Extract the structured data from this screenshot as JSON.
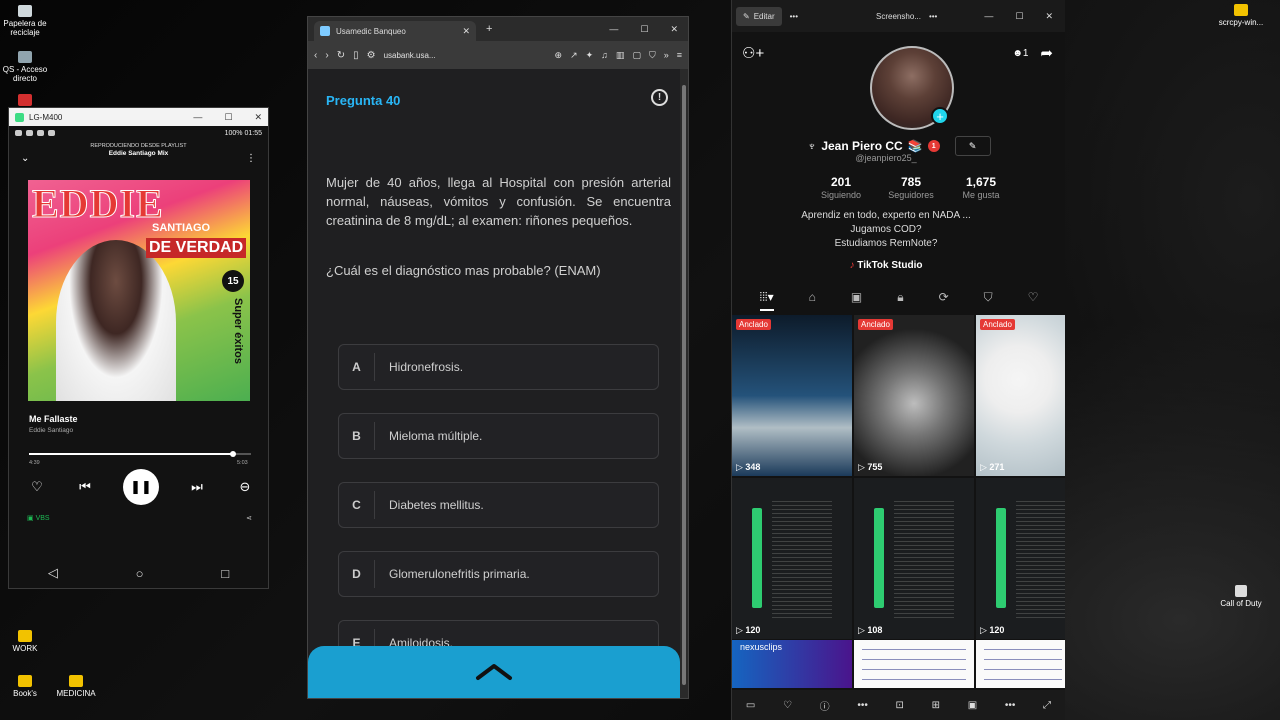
{
  "desktop": {
    "icons": [
      {
        "label": "Papelera de reciclaje"
      },
      {
        "label": "QS - Acceso directo"
      },
      {
        "label": "WORK"
      },
      {
        "label": "Book's"
      },
      {
        "label": "MEDICINA"
      },
      {
        "label": "scrcpy-win..."
      },
      {
        "label": "Call of Duty"
      }
    ]
  },
  "phone": {
    "window_title": "LG-M400",
    "status_right": "100% 01:55",
    "playlist_caption": "REPRODUCIENDO DESDE PLAYLIST",
    "playlist_name": "Eddie Santiago Mix",
    "album": {
      "line1": "EDDIE",
      "line2": "SANTIAGO",
      "line3": "DE VERDAD",
      "line4": "15",
      "line5": "Super éxitos"
    },
    "song_title": "Me Fallaste",
    "artist": "Eddie Santiago",
    "progress": 0.92,
    "time_elapsed": "4:39",
    "time_total": "5:03",
    "device_label": "VBS"
  },
  "browser": {
    "tab_title": "Usamedic Banqueo",
    "url": "usabank.usa...",
    "question_number": "Pregunta 40",
    "question_text": "Mujer de 40 años, llega al Hospital con presión arterial normal, náuseas, vómitos y confusión. Se encuentra creatinina de 8 mg/dL; al examen: riñones pequeños.",
    "question_ask": "¿Cuál es el diagnóstico mas probable? (ENAM)",
    "options": [
      {
        "letter": "A",
        "text": "Hidronefrosis."
      },
      {
        "letter": "B",
        "text": "Mieloma múltiple."
      },
      {
        "letter": "C",
        "text": "Diabetes mellitus."
      },
      {
        "letter": "D",
        "text": "Glomerulonefritis primaria."
      },
      {
        "letter": "E",
        "text": "Amiloidosis."
      }
    ],
    "accent": "#29b6f6"
  },
  "tiktok": {
    "edit_label": "Editar",
    "window_title": "Screensho...",
    "notif_count": "1",
    "display_name": "Jean Piero CC",
    "badge": "1",
    "handle": "@jeanpiero25_",
    "stats": [
      {
        "n": "201",
        "l": "Siguiendo"
      },
      {
        "n": "785",
        "l": "Seguidores"
      },
      {
        "n": "1,675",
        "l": "Me gusta"
      }
    ],
    "bio": [
      "Aprendiz en todo, experto en NADA ...",
      "Jugamos COD?",
      "Estudiamos RemNote?"
    ],
    "studio": "TikTok Studio",
    "pinned_label": "Anclado",
    "videos": [
      {
        "views": "348",
        "pinned": true
      },
      {
        "views": "755",
        "pinned": true
      },
      {
        "views": "271",
        "pinned": true
      },
      {
        "views": "120",
        "pinned": false
      },
      {
        "views": "108",
        "pinned": false
      },
      {
        "views": "120",
        "pinned": false
      }
    ],
    "bottom_tile_label": "nexusclips"
  }
}
